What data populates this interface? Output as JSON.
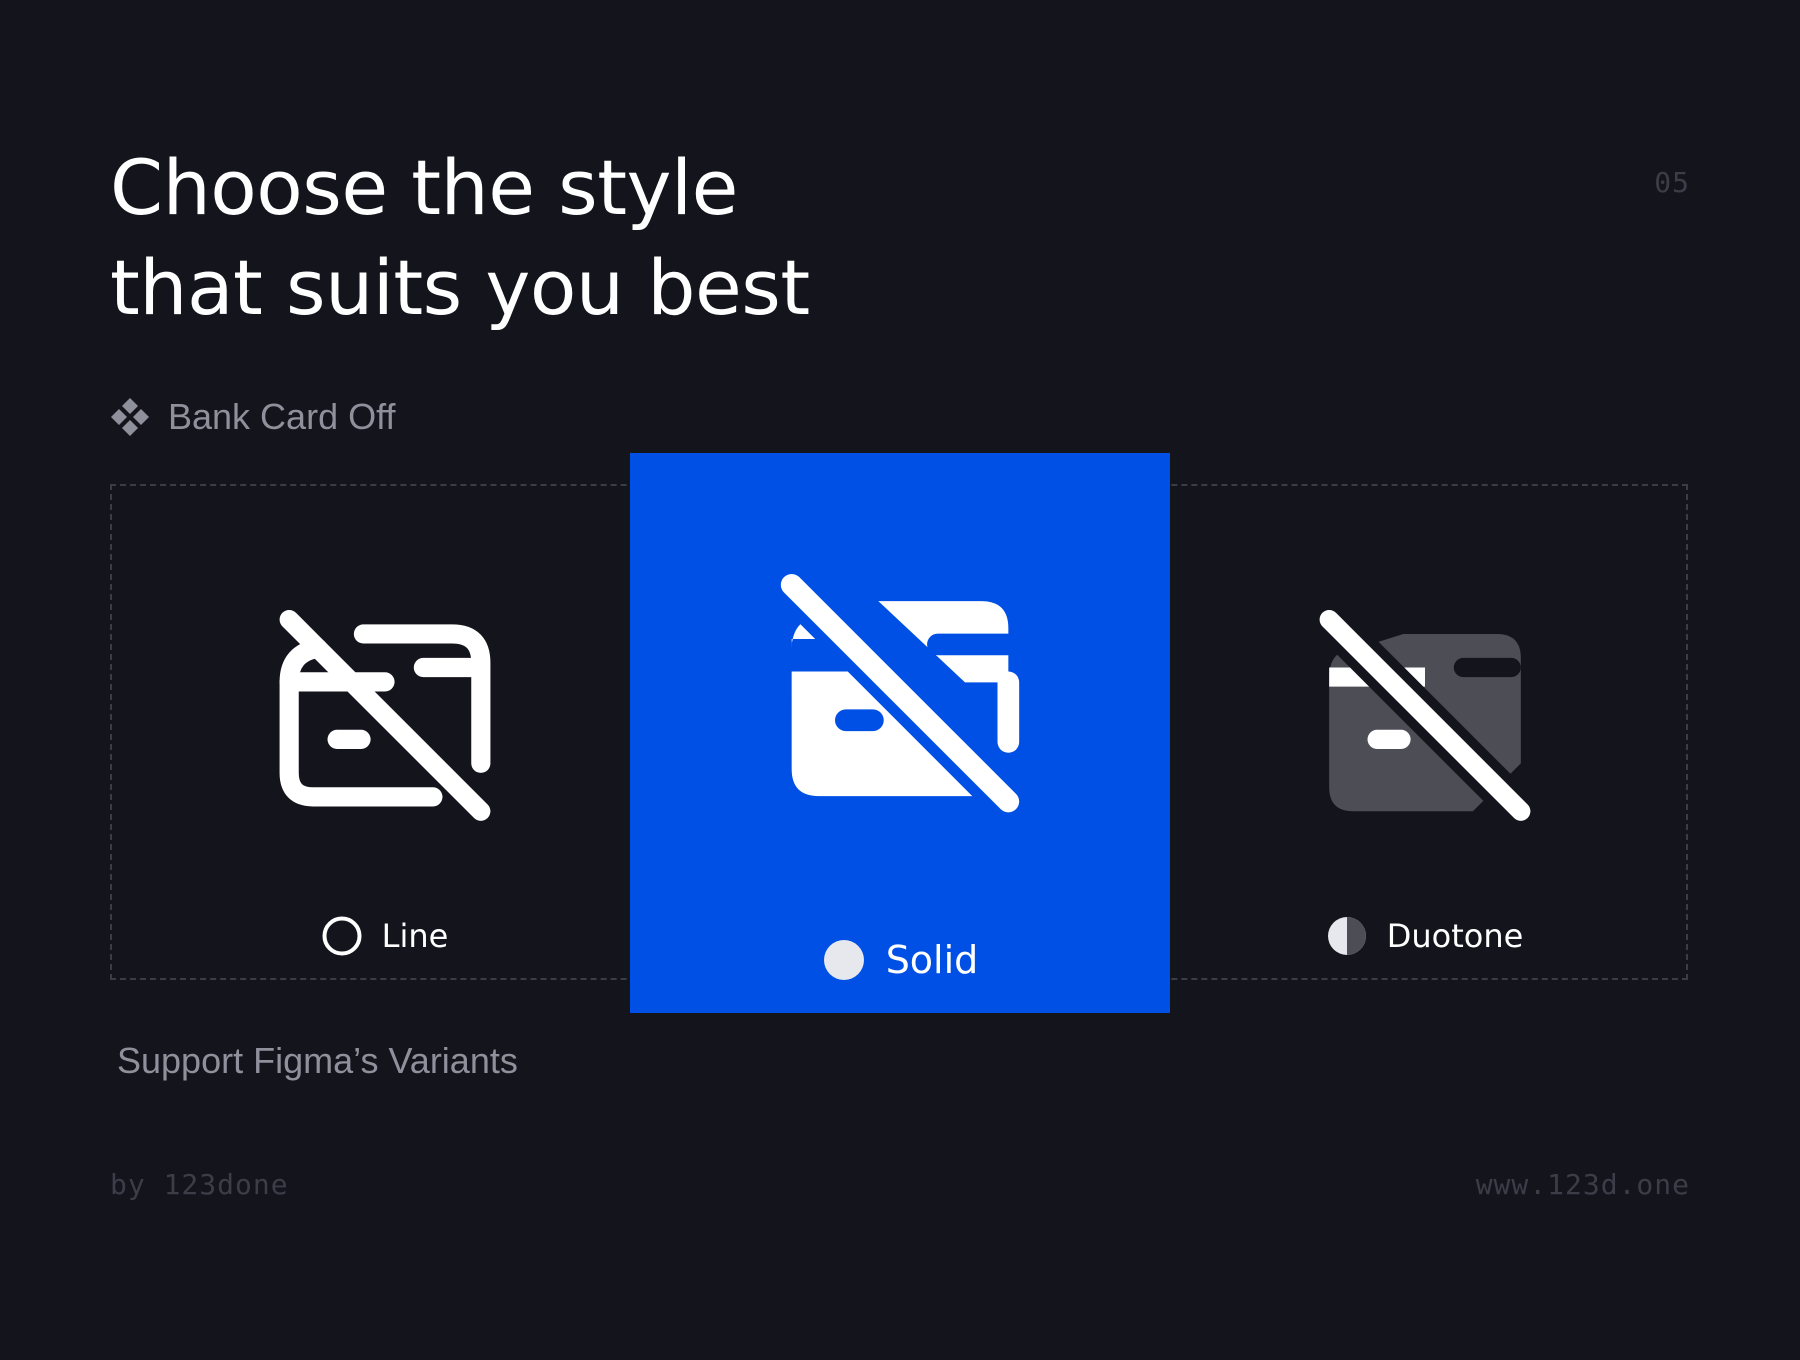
{
  "headline": {
    "line1": "Choose the style",
    "line2": "that suits you best"
  },
  "page_number": "05",
  "component": {
    "icon": "figma-component-icon",
    "label": "Bank Card Off"
  },
  "variants": [
    {
      "id": "line",
      "label": "Line",
      "indicator": "circle-outline-icon",
      "selected": false
    },
    {
      "id": "solid",
      "label": "Solid",
      "indicator": "circle-filled-icon",
      "selected": true
    },
    {
      "id": "duotone",
      "label": "Duotone",
      "indicator": "circle-half-icon",
      "selected": false
    }
  ],
  "tagline": "Support Figma’s Variants",
  "footer": {
    "author": "by 123done",
    "website": "www.123d.one"
  },
  "colors": {
    "background": "#14141c",
    "accent": "#0050e6",
    "text_primary": "#ffffff",
    "text_secondary": "#8e909c",
    "text_muted": "#3b3d48",
    "duotone_secondary": "#4d4e55"
  }
}
